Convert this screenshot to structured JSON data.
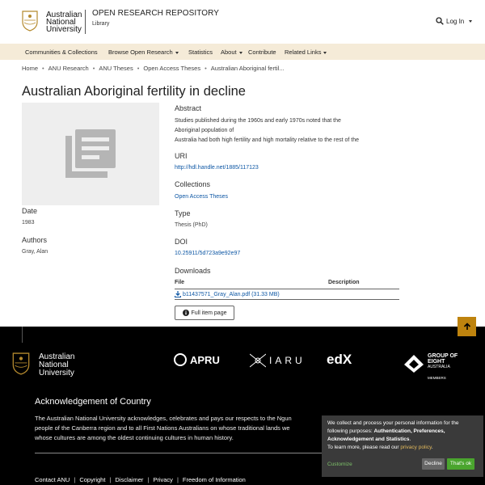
{
  "header": {
    "university_line1": "Australian",
    "university_line2": "National",
    "university_line3": "University",
    "repository_title": "OPEN RESEARCH REPOSITORY",
    "repository_subtitle": "Library",
    "login_label": "Log In"
  },
  "nav": {
    "items": [
      {
        "label": "Communities & Collections"
      },
      {
        "label": "Browse Open Research"
      },
      {
        "label": "Statistics"
      },
      {
        "label": "About"
      },
      {
        "label": "Contribute"
      },
      {
        "label": "Related Links"
      }
    ]
  },
  "breadcrumb": [
    "Home",
    "ANU Research",
    "ANU Theses",
    "Open Access Theses",
    "Australian Aboriginal fertil..."
  ],
  "item": {
    "title": "Australian Aboriginal fertility in decline",
    "date_label": "Date",
    "date_value": "1983",
    "authors_label": "Authors",
    "authors_value": "Gray, Alan",
    "abstract_label": "Abstract",
    "abstract_line1": "Studies published during the 1960s and early 1970s noted that the",
    "abstract_line2": "Aboriginal population of",
    "abstract_line3": "Australia had both high fertility and high mortality relative to the rest of the",
    "uri_label": "URI",
    "uri_value": "http://hdl.handle.net/1885/117123",
    "collections_label": "Collections",
    "collections_value": "Open Access Theses",
    "type_label": "Type",
    "type_value": "Thesis (PhD)",
    "doi_label": "DOI",
    "doi_value": "10.25911/5d723a9e92e97",
    "downloads_label": "Downloads",
    "file_header": "File",
    "description_header": "Description",
    "file_name": "b11437571_Gray_Alan.pdf (31.33 MB)",
    "full_item_label": "Full item page"
  },
  "footer": {
    "uni_line1": "Australian",
    "uni_line2": "National",
    "uni_line3": "University",
    "partner_apru": "APRU",
    "partner_iaru": "IARU",
    "partner_edx": "edX",
    "partner_go8_line1": "GROUP OF",
    "partner_go8_line2": "EIGHT",
    "partner_go8_line3": "AUSTRALIA",
    "partner_go8_line4": "MEMBERS",
    "ack_title": "Acknowledgement of Country",
    "ack_line1": "The Australian National University acknowledges, celebrates and pays our respects to the Ngun",
    "ack_line2": "people of the Canberra region and to all First Nations Australians on whose traditional lands we",
    "ack_line3": "whose cultures are among the oldest continuing cultures in human history.",
    "links": [
      "Contact ANU",
      "Copyright",
      "Disclaimer",
      "Privacy",
      "Freedom of Information"
    ]
  },
  "cookie": {
    "text_part1": "We collect and process your personal information for the following purposes: ",
    "text_bold": "Authentication, Preferences, Acknowledgement and Statistics",
    "text_part2": ".",
    "learn_more": "To learn more, please read our ",
    "privacy_link": "privacy policy",
    "customize_label": "Customize",
    "decline_label": "Decline",
    "ok_label": "That's ok"
  },
  "colors": {
    "nav_bg": "#f5ebd8",
    "link": "#0c56a4",
    "back_to_top": "#be830e",
    "ok_button": "#4aa52e",
    "footer_bg": "#000000"
  }
}
